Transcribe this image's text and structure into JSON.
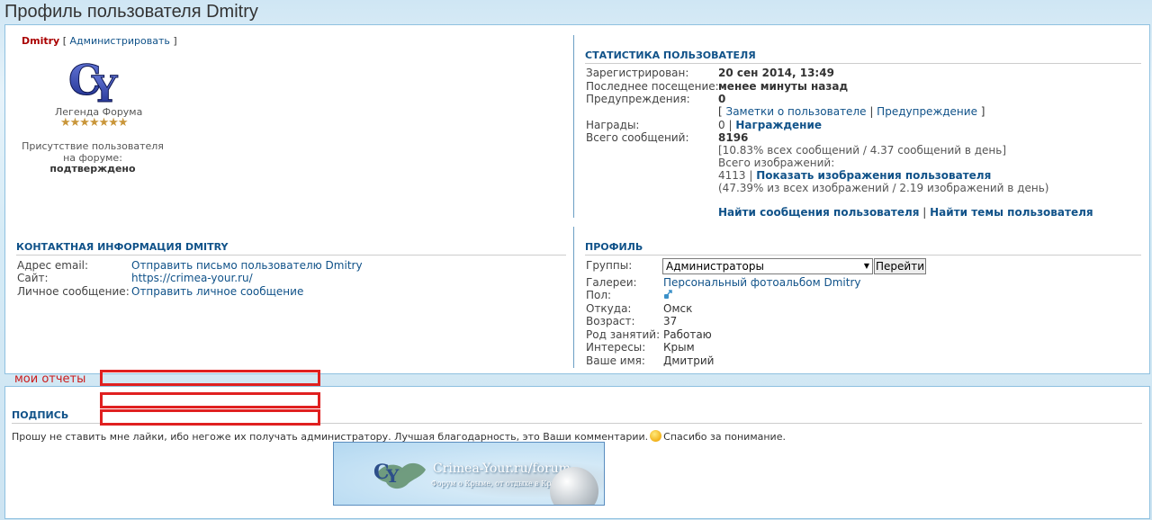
{
  "page": {
    "title": "Профиль пользователя Dmitry"
  },
  "user": {
    "name": "Dmitry",
    "admin_link": "Администрировать",
    "rank": "Легенда Форума",
    "stars": "★★★★★★★",
    "presence_text": "Присутствие пользователя на форуме:",
    "presence_value": "подтверждено"
  },
  "stats": {
    "heading": "Статистика пользователя",
    "registered_label": "Зарегистрирован:",
    "registered_value": "20 сен 2014, 13:49",
    "last_visit_label": "Последнее посещение:",
    "last_visit_value": "менее минуты назад",
    "warnings_label": "Предупреждения:",
    "warnings_value": "0",
    "notes_link": "Заметки о пользователе",
    "warning_link": "Предупреждение",
    "awards_label": "Награды:",
    "awards_value": "0",
    "awards_link": "Награждение",
    "posts_label": "Всего сообщений:",
    "posts_value": "8196",
    "posts_detail": "[10.83% всех сообщений / 4.37 сообщений в день]",
    "images_label": "Всего изображений:",
    "images_value": "4113",
    "images_link": "Показать изображения пользователя",
    "images_detail": "(47.39% из всех изображений / 2.19 изображений в день)",
    "find_posts": "Найти сообщения пользователя",
    "find_topics": "Найти темы пользователя"
  },
  "contact": {
    "heading": "Контактная информация Dmitry",
    "email_label": "Адрес email:",
    "email_link": "Отправить письмо пользователю Dmitry",
    "site_label": "Сайт:",
    "site_link": "https://crimea-your.ru/",
    "pm_label": "Личное сообщение:",
    "pm_link": "Отправить личное сообщение"
  },
  "profile": {
    "heading": "Профиль",
    "groups_label": "Группы:",
    "groups_selected": "Администраторы",
    "go_button": "Перейти",
    "gallery_label": "Галереи:",
    "gallery_link": "Персональный фотоальбом Dmitry",
    "gender_label": "Пол:",
    "from_label": "Откуда:",
    "from_value": "Омск",
    "age_label": "Возраст:",
    "age_value": "37",
    "occupation_label": "Род занятий:",
    "occupation_value": "Работаю",
    "interests_label": "Интересы:",
    "interests_value": "Крым",
    "realname_label": "Ваше имя:",
    "realname_value": "Дмитрий"
  },
  "reports": {
    "label": "мои отчеты"
  },
  "signature": {
    "heading": "Подпись",
    "text_before": "Прошу не ставить мне лайки, ибо негоже их получать администратору. Лучшая благодарность, это Ваши комментарии.",
    "text_after": "Спасибо за понимание.",
    "banner_title": "Crimea-Your.ru/forum",
    "banner_sub": "Форум о Крыме, от отдыхе в Крыму"
  },
  "colors": {
    "link": "#105289",
    "highlight": "#e02020",
    "username": "#aa0000"
  }
}
